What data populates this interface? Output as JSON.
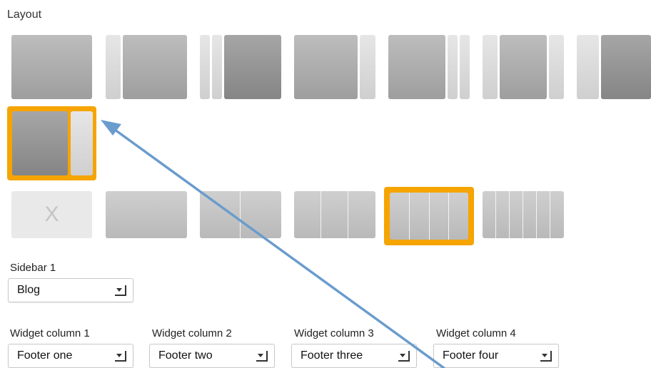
{
  "layout": {
    "title": "Layout",
    "options": [
      "full-width",
      "narrow-left-sidebar",
      "two-narrow-left-sidebars",
      "narrow-right-sidebar",
      "two-narrow-right-sidebars",
      "sidebars-both-sides",
      "narrow-left-sidebar-dark",
      "wide-left-narrow-right-selected"
    ],
    "selected": "wide-left-narrow-right-selected"
  },
  "footer_columns": {
    "options": [
      "none",
      "1",
      "2",
      "3",
      "4",
      "6"
    ],
    "none_glyph": "X",
    "selected": "4"
  },
  "sidebar": {
    "label": "Sidebar 1",
    "value": "Blog"
  },
  "widgets": [
    {
      "label": "Widget column 1",
      "value": "Footer one"
    },
    {
      "label": "Widget column 2",
      "value": "Footer two"
    },
    {
      "label": "Widget column 3",
      "value": "Footer three"
    },
    {
      "label": "Widget column 4",
      "value": "Footer four"
    }
  ],
  "colors": {
    "selection": "#f6a400",
    "arrow": "#6a9ccd"
  }
}
